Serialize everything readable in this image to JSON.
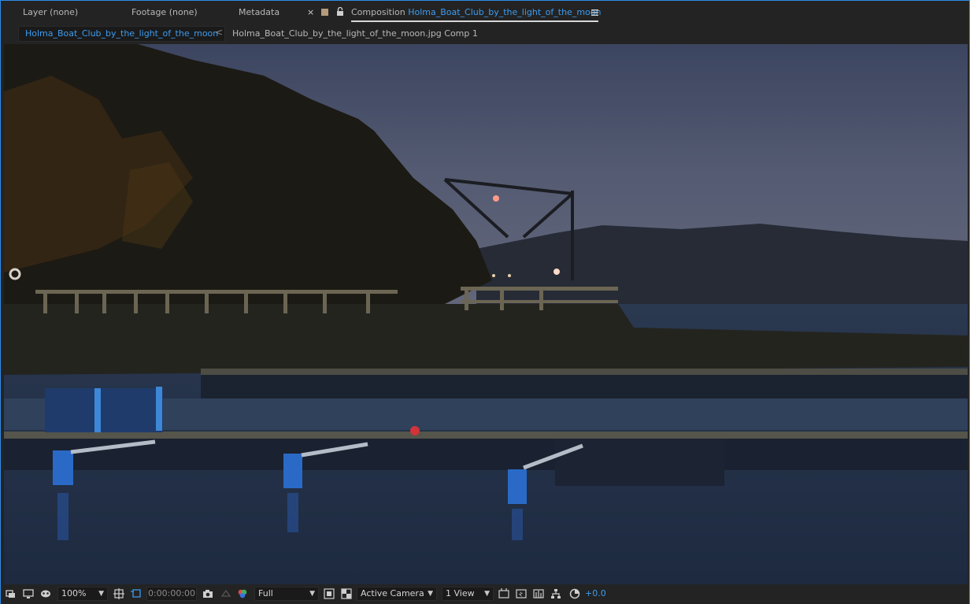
{
  "tabs": {
    "layer": "Layer (none)",
    "footage": "Footage (none)",
    "metadata": "Metadata",
    "close": "×",
    "composition_prefix": "Composition",
    "composition_name": "Holma_Boat_Club_by_the_light_of_the_moon"
  },
  "breadcrumb": {
    "active": "Holma_Boat_Club_by_the_light_of_the_moon",
    "arrow": "<",
    "next": "Holma_Boat_Club_by_the_light_of_the_moon.jpg Comp 1"
  },
  "toolbar": {
    "zoom": "100%",
    "timecode": "0:00:00:00",
    "resolution": "Full",
    "camera": "Active Camera",
    "views": "1 View",
    "exposure": "+0.0"
  },
  "colors": {
    "accent": "#3c9cf0",
    "label_swatch": "#b59b7c"
  },
  "icons": {
    "lock": "lock-icon",
    "menu": "hamburger-menu-icon",
    "always_preview": "always-preview-icon",
    "monitor": "monitor-icon",
    "mask": "mask-visibility-icon",
    "snapshot": "camera-snapshot-icon",
    "show_snapshot": "show-snapshot-icon",
    "channel": "rgb-channel-icon",
    "region": "region-of-interest-icon",
    "transparency": "transparency-grid-icon",
    "fast_preview": "fast-preview-icon",
    "timeline": "timeline-icon",
    "flowchart": "flowchart-icon",
    "reset_exposure": "reset-exposure-icon"
  }
}
